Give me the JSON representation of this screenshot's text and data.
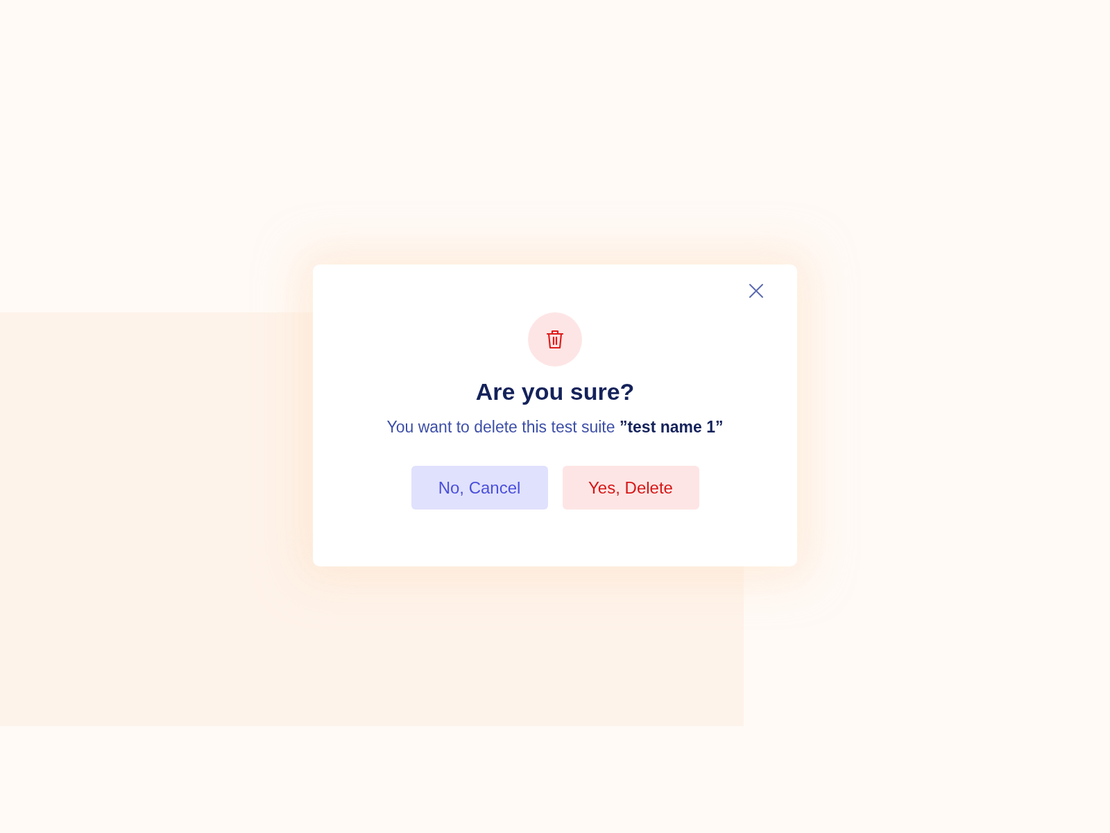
{
  "dialog": {
    "title": "Are you sure?",
    "message": "You want to delete this test suite **”test name 1”**",
    "buttons": [
      {
        "label": "No, Cancel",
        "kind": "cancel"
      },
      {
        "label": "Yes, Delete",
        "kind": "delete"
      }
    ]
  }
}
